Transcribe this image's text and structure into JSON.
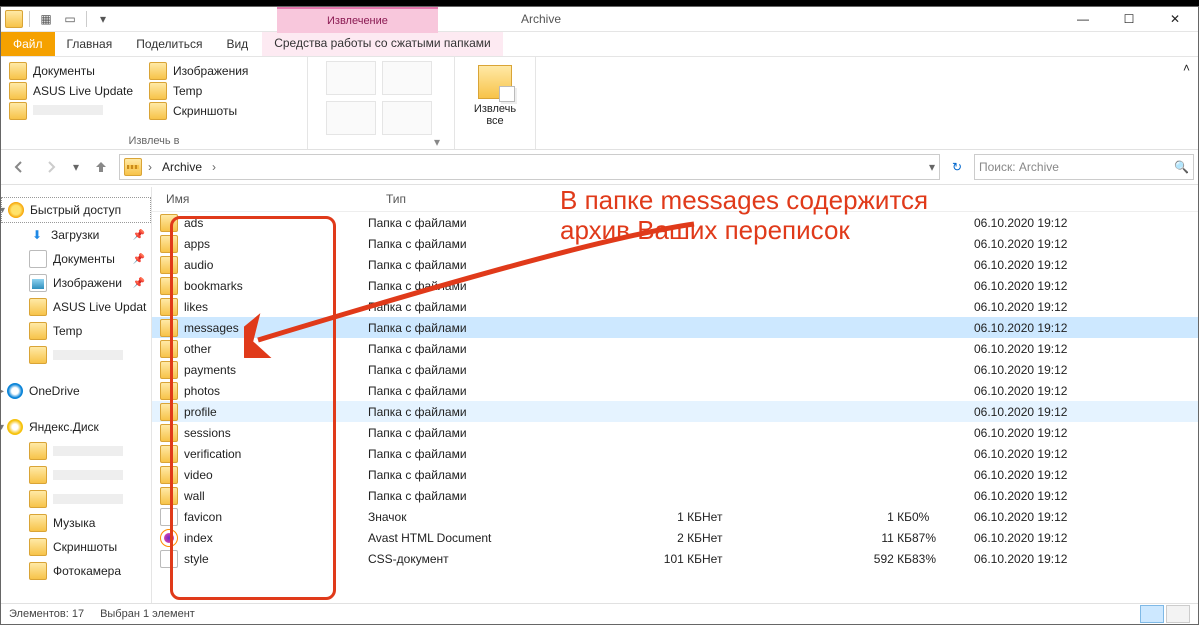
{
  "window": {
    "context_tab": "Извлечение",
    "title": "Archive"
  },
  "tabs": {
    "file": "Файл",
    "home": "Главная",
    "share": "Поделиться",
    "view": "Вид",
    "ctx": "Средства работы со сжатыми папками"
  },
  "ribbon": {
    "destinations": [
      "Документы",
      "Изображения",
      "ASUS Live Update",
      "Temp",
      "",
      "Скриншоты"
    ],
    "group_label": "Извлечь в",
    "extract_all": "Извлечь\nвсе"
  },
  "nav": {
    "breadcrumb": [
      "Archive"
    ],
    "search_placeholder": "Поиск: Archive"
  },
  "tree": [
    {
      "kind": "group",
      "icon": "star",
      "label": "Быстрый доступ",
      "focused": true
    },
    {
      "kind": "sub",
      "icon": "dl",
      "label": "Загрузки",
      "pin": true
    },
    {
      "kind": "sub",
      "icon": "doc",
      "label": "Документы",
      "pin": true
    },
    {
      "kind": "sub",
      "icon": "img",
      "label": "Изображени",
      "pin": true
    },
    {
      "kind": "sub",
      "icon": "folder",
      "label": "ASUS Live Updat"
    },
    {
      "kind": "sub",
      "icon": "folder",
      "label": "Temp"
    },
    {
      "kind": "sub",
      "icon": "blur",
      "label": ""
    },
    {
      "kind": "spacer"
    },
    {
      "kind": "group",
      "icon": "od",
      "label": "OneDrive"
    },
    {
      "kind": "spacer"
    },
    {
      "kind": "group",
      "icon": "yd",
      "label": "Яндекс.Диск"
    },
    {
      "kind": "sub",
      "icon": "blur",
      "label": ""
    },
    {
      "kind": "sub",
      "icon": "blur",
      "label": ""
    },
    {
      "kind": "sub",
      "icon": "blur",
      "label": ""
    },
    {
      "kind": "sub",
      "icon": "folder",
      "label": "Музыка"
    },
    {
      "kind": "sub",
      "icon": "folder",
      "label": "Скриншоты"
    },
    {
      "kind": "sub",
      "icon": "folder",
      "label": "Фотокамера"
    }
  ],
  "columns": {
    "name": "Имя",
    "type": "Тип",
    "csize": "",
    "pwd": "",
    "size": "",
    "ratio": "",
    "date": ""
  },
  "rows": [
    {
      "name": "ads",
      "type": "Папка с файлами",
      "csize": "",
      "pwd": "",
      "size": "",
      "ratio": "",
      "date": "06.10.2020 19:12",
      "ico": "folder"
    },
    {
      "name": "apps",
      "type": "Папка с файлами",
      "csize": "",
      "pwd": "",
      "size": "",
      "ratio": "",
      "date": "06.10.2020 19:12",
      "ico": "folder"
    },
    {
      "name": "audio",
      "type": "Папка с файлами",
      "csize": "",
      "pwd": "",
      "size": "",
      "ratio": "",
      "date": "06.10.2020 19:12",
      "ico": "folder"
    },
    {
      "name": "bookmarks",
      "type": "Папка с файлами",
      "csize": "",
      "pwd": "",
      "size": "",
      "ratio": "",
      "date": "06.10.2020 19:12",
      "ico": "folder"
    },
    {
      "name": "likes",
      "type": "Папка с файлами",
      "csize": "",
      "pwd": "",
      "size": "",
      "ratio": "",
      "date": "06.10.2020 19:12",
      "ico": "folder"
    },
    {
      "name": "messages",
      "type": "Папка с файлами",
      "csize": "",
      "pwd": "",
      "size": "",
      "ratio": "",
      "date": "06.10.2020 19:12",
      "ico": "folder",
      "sel": true
    },
    {
      "name": "other",
      "type": "Папка с файлами",
      "csize": "",
      "pwd": "",
      "size": "",
      "ratio": "",
      "date": "06.10.2020 19:12",
      "ico": "folder"
    },
    {
      "name": "payments",
      "type": "Папка с файлами",
      "csize": "",
      "pwd": "",
      "size": "",
      "ratio": "",
      "date": "06.10.2020 19:12",
      "ico": "folder"
    },
    {
      "name": "photos",
      "type": "Папка с файлами",
      "csize": "",
      "pwd": "",
      "size": "",
      "ratio": "",
      "date": "06.10.2020 19:12",
      "ico": "folder"
    },
    {
      "name": "profile",
      "type": "Папка с файлами",
      "csize": "",
      "pwd": "",
      "size": "",
      "ratio": "",
      "date": "06.10.2020 19:12",
      "ico": "folder",
      "hover": true
    },
    {
      "name": "sessions",
      "type": "Папка с файлами",
      "csize": "",
      "pwd": "",
      "size": "",
      "ratio": "",
      "date": "06.10.2020 19:12",
      "ico": "folder"
    },
    {
      "name": "verification",
      "type": "Папка с файлами",
      "csize": "",
      "pwd": "",
      "size": "",
      "ratio": "",
      "date": "06.10.2020 19:12",
      "ico": "folder"
    },
    {
      "name": "video",
      "type": "Папка с файлами",
      "csize": "",
      "pwd": "",
      "size": "",
      "ratio": "",
      "date": "06.10.2020 19:12",
      "ico": "folder"
    },
    {
      "name": "wall",
      "type": "Папка с файлами",
      "csize": "",
      "pwd": "",
      "size": "",
      "ratio": "",
      "date": "06.10.2020 19:12",
      "ico": "folder"
    },
    {
      "name": "favicon",
      "type": "Значок",
      "csize": "1 КБ",
      "pwd": "Нет",
      "size": "1 КБ",
      "ratio": "0%",
      "date": "06.10.2020 19:12",
      "ico": "file"
    },
    {
      "name": "index",
      "type": "Avast HTML Document",
      "csize": "2 КБ",
      "pwd": "Нет",
      "size": "11 КБ",
      "ratio": "87%",
      "date": "06.10.2020 19:12",
      "ico": "htm"
    },
    {
      "name": "style",
      "type": "CSS-документ",
      "csize": "101 КБ",
      "pwd": "Нет",
      "size": "592 КБ",
      "ratio": "83%",
      "date": "06.10.2020 19:12",
      "ico": "css"
    }
  ],
  "status": {
    "count": "Элементов: 17",
    "selection": "Выбран 1 элемент"
  },
  "annotation": {
    "line1": "В папке messages содержится",
    "line2": "архив Ваших переписок"
  }
}
